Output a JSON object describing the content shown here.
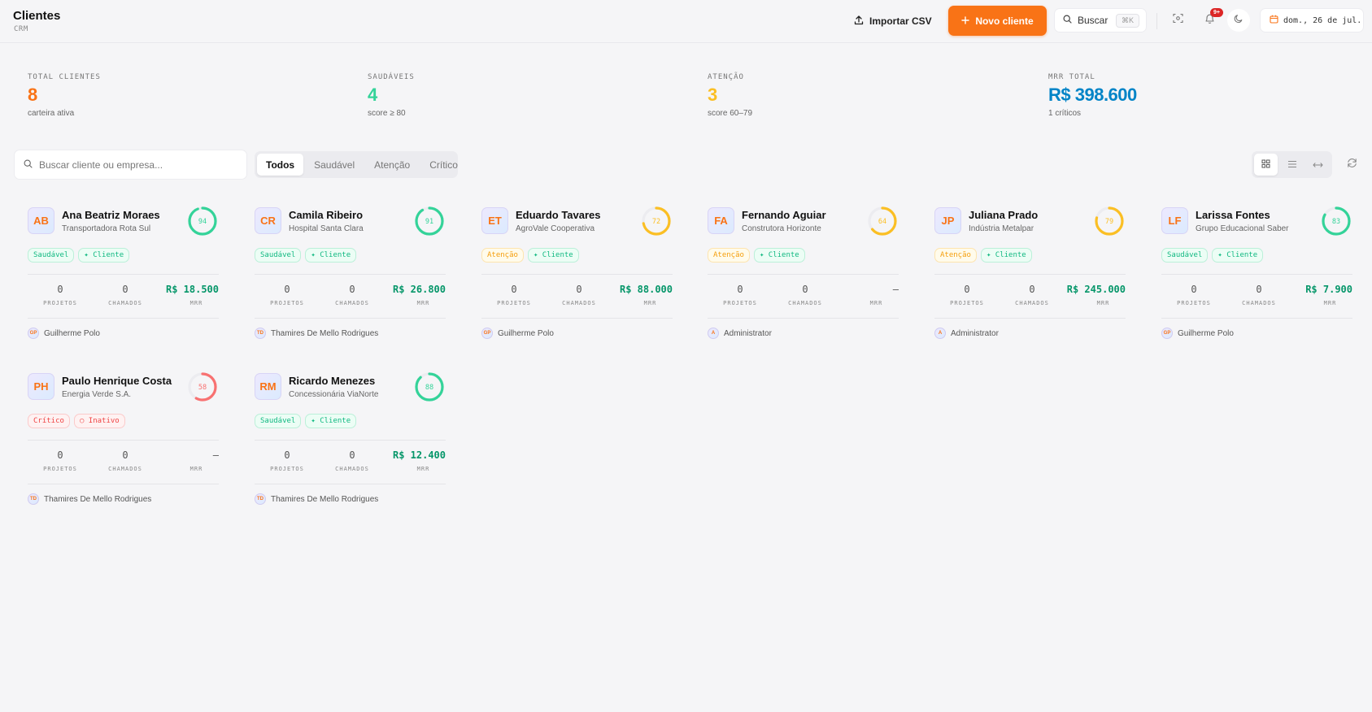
{
  "header": {
    "title": "Clientes",
    "subtitle": "CRM",
    "import_label": "Importar CSV",
    "new_client_label": "Novo cliente",
    "search_label": "Buscar",
    "search_shortcut": "⌘K",
    "notifications_badge": "9+",
    "date": "dom., 26 de jul."
  },
  "stats": [
    {
      "label": "TOTAL CLIENTES",
      "value": "8",
      "note": "carteira ativa",
      "color": "#f97316"
    },
    {
      "label": "SAUDÁVEIS",
      "value": "4",
      "note": "score ≥ 80",
      "color": "#34d399"
    },
    {
      "label": "ATENÇÃO",
      "value": "3",
      "note": "score 60–79",
      "color": "#fbbf24"
    },
    {
      "label": "MRR TOTAL",
      "value": "R$ 398.600",
      "note": "1 críticos",
      "color": "#0284c7"
    }
  ],
  "search": {
    "placeholder": "Buscar cliente ou empresa...",
    "value": ""
  },
  "filters": {
    "all": "Todos",
    "healthy": "Saudável",
    "attention": "Atenção",
    "critical": "Crítico",
    "active": "all"
  },
  "metric_labels": {
    "projects": "PROJETOS",
    "tickets": "CHAMADOS",
    "mrr": "MRR"
  },
  "colors": {
    "healthy": "#34d399",
    "attention": "#fbbf24",
    "critical": "#f87171",
    "accent": "#f97316"
  },
  "clients": [
    {
      "initials": "AB",
      "name": "Ana Beatriz Moraes",
      "company": "Transportadora Rota Sul",
      "score": 94,
      "status": "healthy",
      "tags": [
        "Saudável",
        "✦ Cliente"
      ],
      "projects": "0",
      "tickets": "0",
      "mrr": "R$ 18.500",
      "owner_initials": "GP",
      "owner": "Guilherme Polo"
    },
    {
      "initials": "CR",
      "name": "Camila Ribeiro",
      "company": "Hospital Santa Clara",
      "score": 91,
      "status": "healthy",
      "tags": [
        "Saudável",
        "✦ Cliente"
      ],
      "projects": "0",
      "tickets": "0",
      "mrr": "R$ 26.800",
      "owner_initials": "TD",
      "owner": "Thamires De Mello Rodrigues"
    },
    {
      "initials": "ET",
      "name": "Eduardo Tavares",
      "company": "AgroVale Cooperativa",
      "score": 72,
      "status": "attention",
      "tags": [
        "Atenção",
        "✦ Cliente"
      ],
      "projects": "0",
      "tickets": "0",
      "mrr": "R$ 88.000",
      "owner_initials": "GP",
      "owner": "Guilherme Polo"
    },
    {
      "initials": "FA",
      "name": "Fernando Aguiar",
      "company": "Construtora Horizonte",
      "score": 64,
      "status": "attention",
      "tags": [
        "Atenção",
        "✦ Cliente"
      ],
      "projects": "0",
      "tickets": "0",
      "mrr": "—",
      "owner_initials": "A",
      "owner": "Administrator"
    },
    {
      "initials": "JP",
      "name": "Juliana Prado",
      "company": "Indústria Metalpar",
      "score": 79,
      "status": "attention",
      "tags": [
        "Atenção",
        "✦ Cliente"
      ],
      "projects": "0",
      "tickets": "0",
      "mrr": "R$ 245.000",
      "owner_initials": "A",
      "owner": "Administrator"
    },
    {
      "initials": "LF",
      "name": "Larissa Fontes",
      "company": "Grupo Educacional Saber",
      "score": 83,
      "status": "healthy",
      "tags": [
        "Saudável",
        "✦ Cliente"
      ],
      "projects": "0",
      "tickets": "0",
      "mrr": "R$ 7.900",
      "owner_initials": "GP",
      "owner": "Guilherme Polo"
    },
    {
      "initials": "PH",
      "name": "Paulo Henrique Costa",
      "company": "Energia Verde S.A.",
      "score": 58,
      "status": "critical",
      "tags": [
        "Crítico",
        "○ Inativo"
      ],
      "projects": "0",
      "tickets": "0",
      "mrr": "—",
      "owner_initials": "TD",
      "owner": "Thamires De Mello Rodrigues"
    },
    {
      "initials": "RM",
      "name": "Ricardo Menezes",
      "company": "Concessionária ViaNorte",
      "score": 88,
      "status": "healthy",
      "tags": [
        "Saudável",
        "✦ Cliente"
      ],
      "projects": "0",
      "tickets": "0",
      "mrr": "R$ 12.400",
      "owner_initials": "TD",
      "owner": "Thamires De Mello Rodrigues"
    }
  ]
}
